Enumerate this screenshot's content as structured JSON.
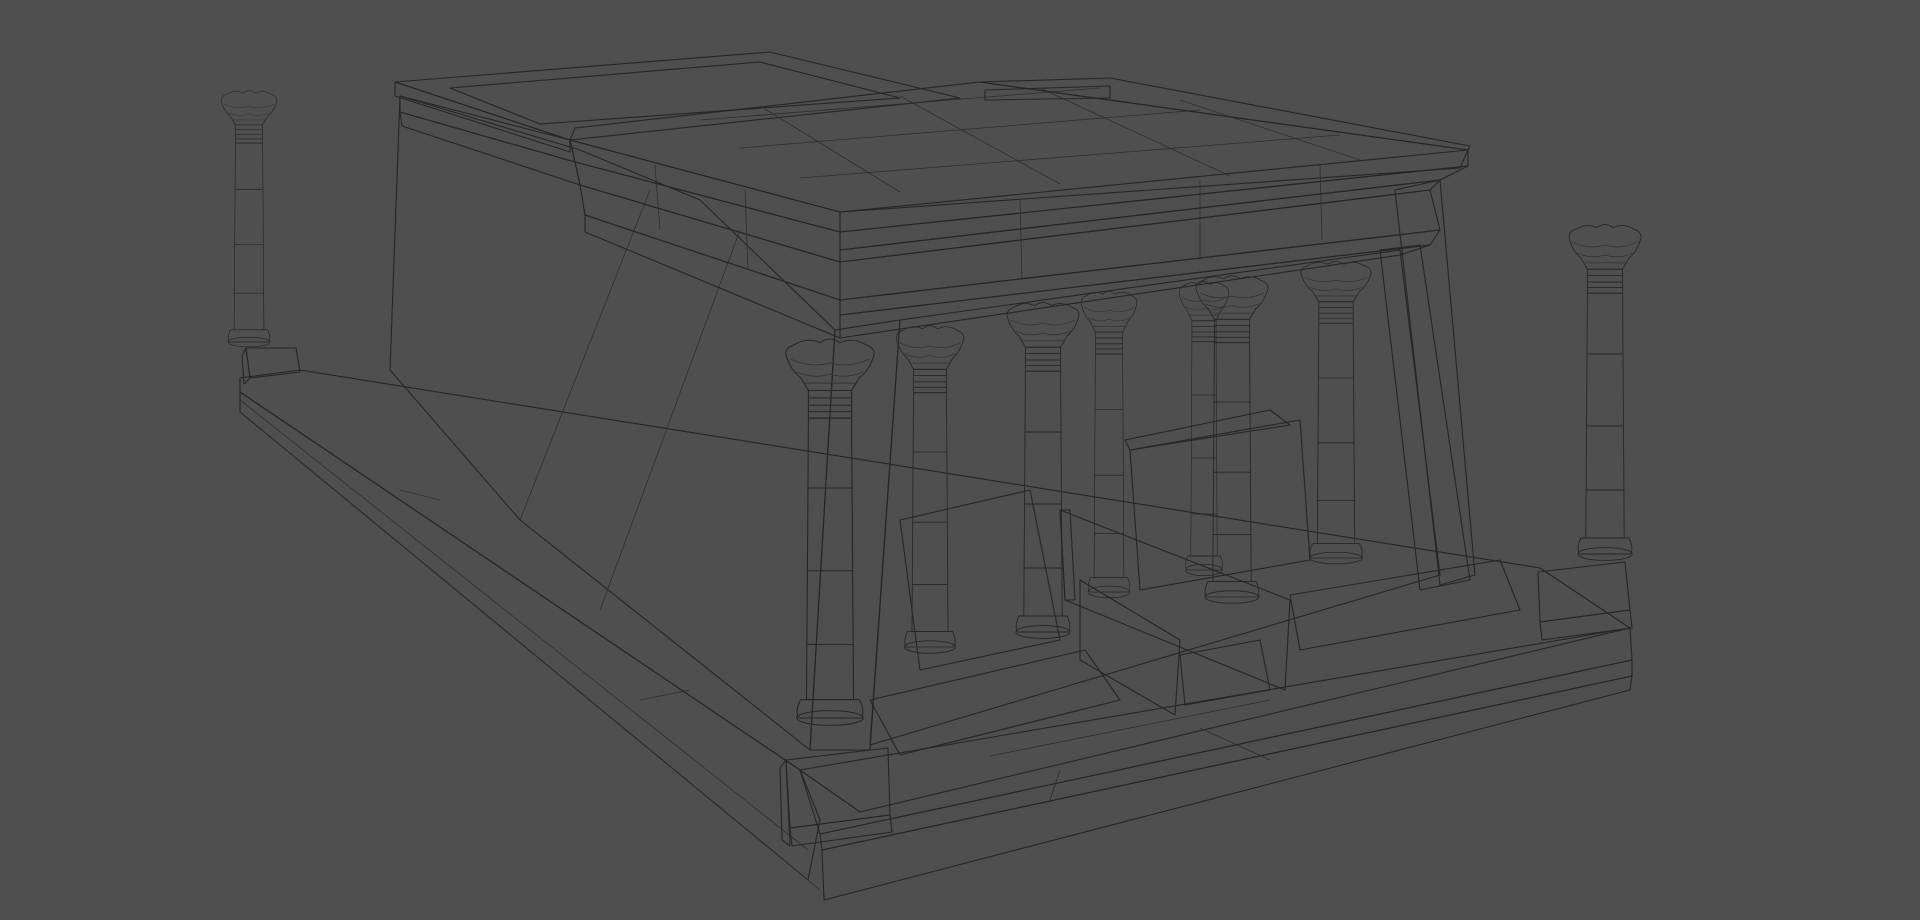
{
  "viewport": {
    "background": "#4f4f4f",
    "render_mode": "shaded-wireframe",
    "surface_color": "#bdbdbd",
    "wire_color": "#262626"
  },
  "scene": {
    "model": "egyptian-temple",
    "parts": [
      "base-platform",
      "battered-walls",
      "flat-roof",
      "portico-columns",
      "front-stairs",
      "free-standing-columns"
    ]
  }
}
